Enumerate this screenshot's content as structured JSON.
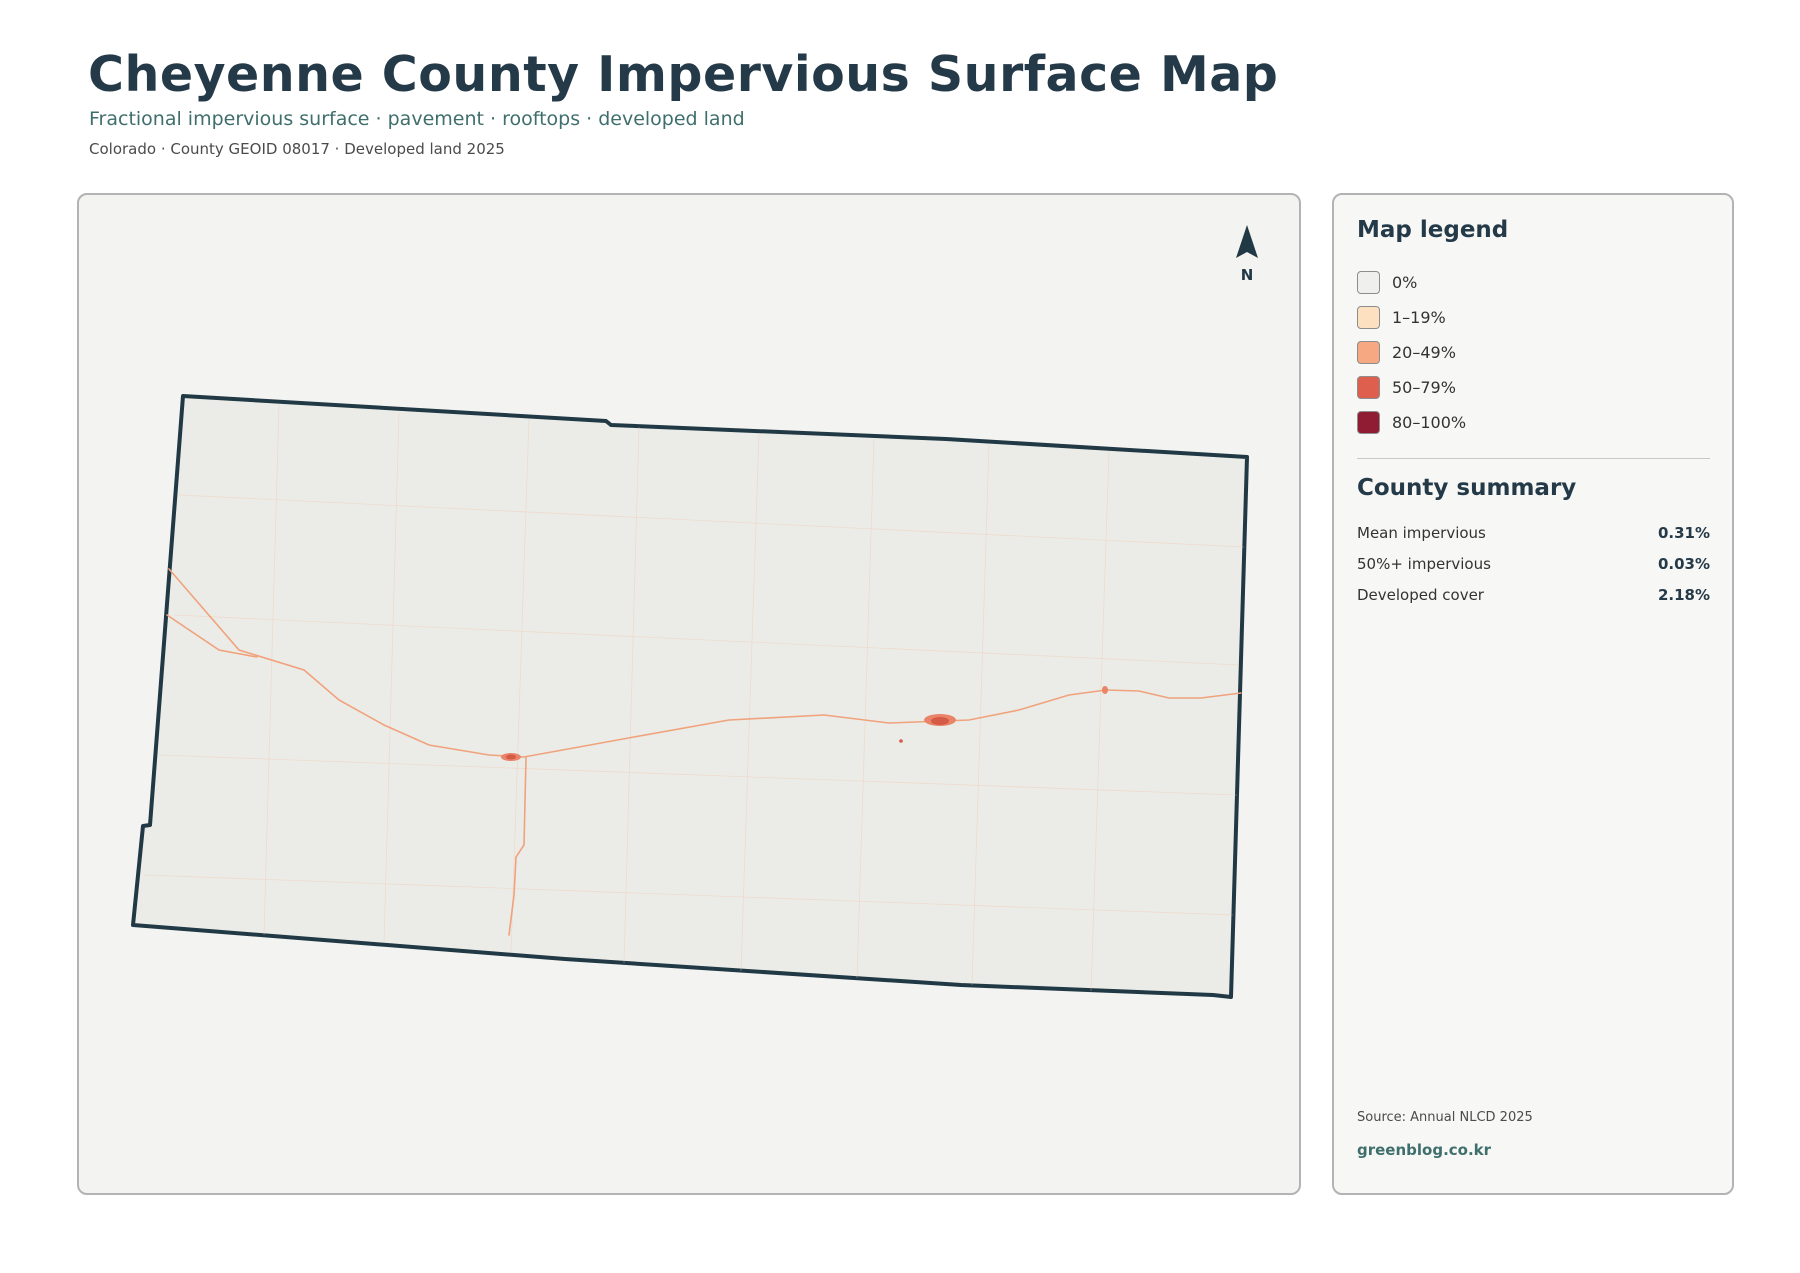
{
  "header": {
    "title": "Cheyenne County Impervious Surface Map",
    "subtitle": "Fractional impervious surface · pavement · rooftops · developed land",
    "meta": "Colorado · County GEOID 08017 · Developed land 2025"
  },
  "map": {
    "north_label": "N",
    "colors": {
      "county_fill": "#ebece7",
      "county_outline": "#213845",
      "road": "#f0a27c",
      "town_core": "#d65b46"
    }
  },
  "legend": {
    "title": "Map legend",
    "items": [
      {
        "label": "0%",
        "color": "#efefed"
      },
      {
        "label": "1–19%",
        "color": "#fde0c0"
      },
      {
        "label": "20–49%",
        "color": "#f5a882"
      },
      {
        "label": "50–79%",
        "color": "#de5f4e"
      },
      {
        "label": "80–100%",
        "color": "#8f1c32"
      }
    ]
  },
  "summary": {
    "title": "County summary",
    "rows": [
      {
        "label": "Mean impervious",
        "value": "0.31%"
      },
      {
        "label": "50%+ impervious",
        "value": "0.03%"
      },
      {
        "label": "Developed cover",
        "value": "2.18%"
      }
    ]
  },
  "footer": {
    "source": "Source: Annual NLCD 2025",
    "credit": "greenblog.co.kr"
  }
}
